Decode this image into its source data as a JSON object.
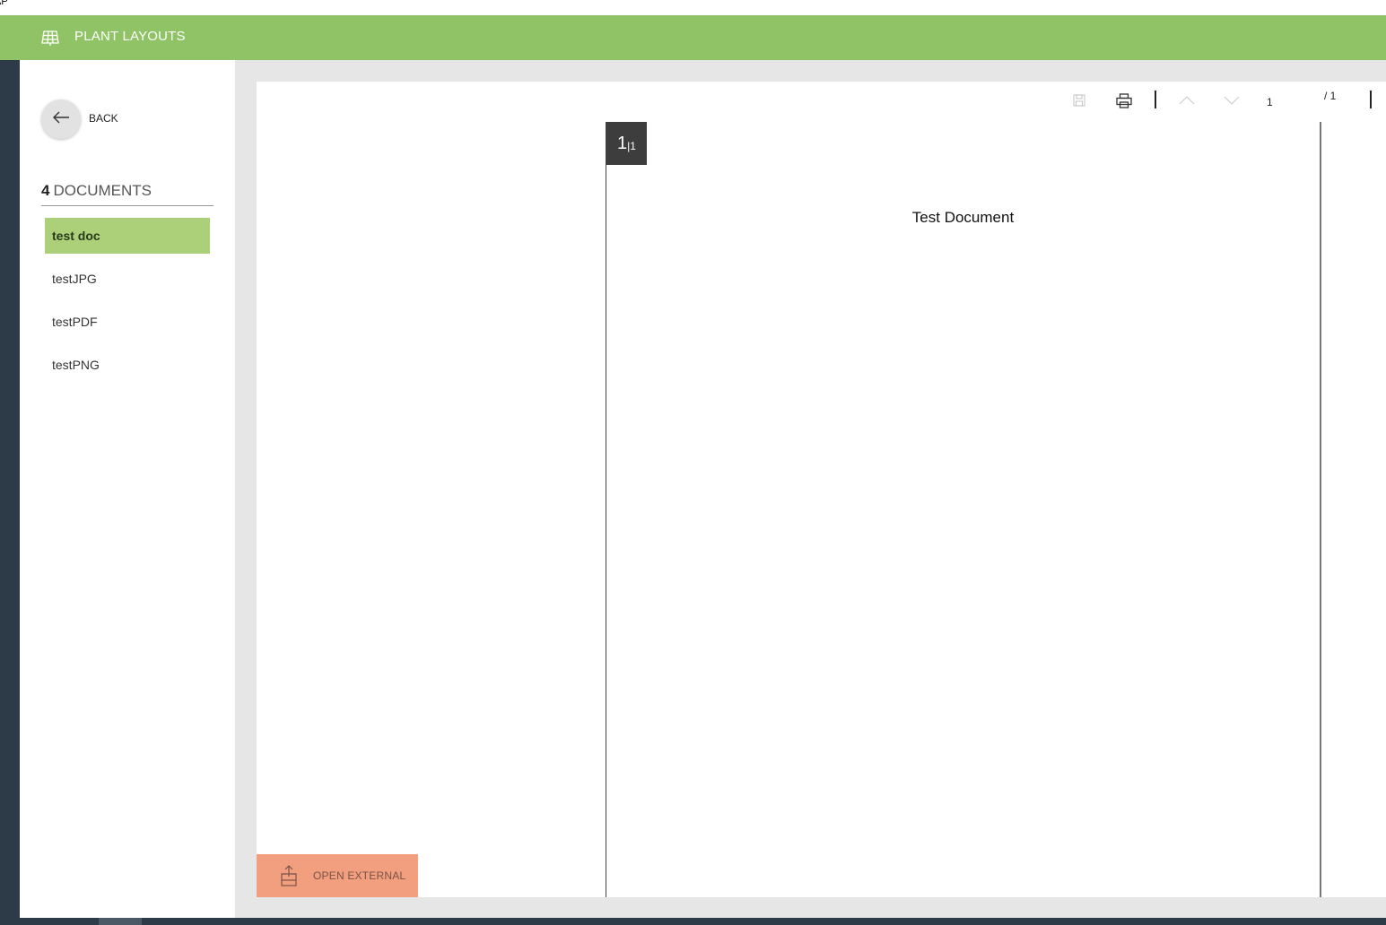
{
  "window": {
    "title_fragment": "AP"
  },
  "header": {
    "title": "PLANT LAYOUTS",
    "icon": "solar-panel-grid-icon",
    "color": "#8fc365"
  },
  "sidebar": {
    "back_label": "BACK",
    "doc_count": "4",
    "doc_count_label": "DOCUMENTS",
    "documents": [
      {
        "label": "test doc",
        "selected": true
      },
      {
        "label": "testJPG",
        "selected": false
      },
      {
        "label": "testPDF",
        "selected": false
      },
      {
        "label": "testPNG",
        "selected": false
      }
    ]
  },
  "viewer": {
    "toolbar": {
      "save_icon": "save-icon",
      "print_icon": "print-icon",
      "prev_icon": "chevron-up-icon",
      "next_icon": "chevron-down-icon",
      "page_value": "1",
      "page_total": "/ 1"
    },
    "page": {
      "badge_current": "1",
      "badge_separator": "|",
      "badge_total": "1",
      "title": "Test Document"
    },
    "open_external_label": "OPEN EXTERNAL",
    "open_external_color": "#f29f7f"
  }
}
